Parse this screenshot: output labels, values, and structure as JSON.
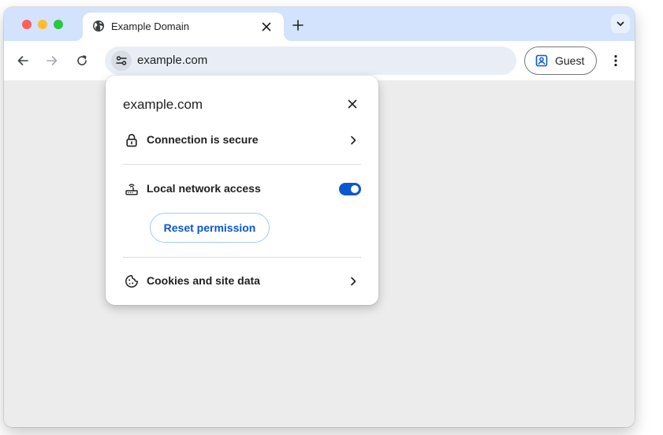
{
  "tab": {
    "title": "Example Domain",
    "favicon_icon": "globe-icon",
    "close_icon": "close-icon"
  },
  "tabstrip": {
    "new_tab_icon": "plus-icon",
    "tab_search_icon": "chevron-down-icon"
  },
  "toolbar": {
    "back_icon": "arrow-left-icon",
    "forward_icon": "arrow-right-icon",
    "reload_icon": "reload-icon",
    "site_info_icon": "tune-icon",
    "url": "example.com",
    "profile_label": "Guest",
    "profile_icon": "person-badge-icon",
    "menu_icon": "more-vertical-icon"
  },
  "page_info": {
    "title": "example.com",
    "close_icon": "close-icon",
    "connection": {
      "label": "Connection is secure",
      "icon": "lock-icon"
    },
    "local_network": {
      "label": "Local network access",
      "icon": "router-icon",
      "enabled": true
    },
    "reset_label": "Reset permission",
    "cookies": {
      "label": "Cookies and site data",
      "icon": "cookie-icon"
    }
  },
  "colors": {
    "tabstrip_bg": "#d3e3fd",
    "omnibox_bg": "#e9eef6",
    "accent": "#0b57d0",
    "traffic_red": "#ff5f57",
    "traffic_yellow": "#febc2e",
    "traffic_green": "#28c840"
  }
}
